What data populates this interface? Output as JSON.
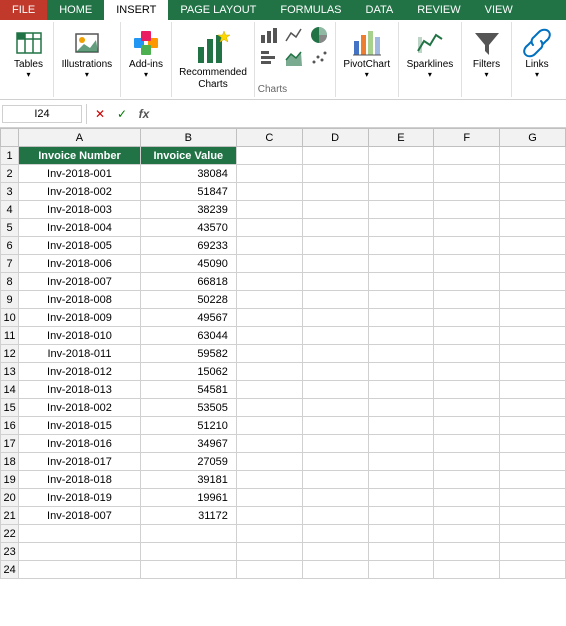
{
  "tabs": [
    {
      "id": "file",
      "label": "FILE"
    },
    {
      "id": "home",
      "label": "HOME"
    },
    {
      "id": "insert",
      "label": "INSERT",
      "active": true
    },
    {
      "id": "page-layout",
      "label": "PAGE LAYOUT"
    },
    {
      "id": "formulas",
      "label": "FORMULAS"
    },
    {
      "id": "data",
      "label": "DATA"
    },
    {
      "id": "review",
      "label": "REVIEW"
    },
    {
      "id": "view",
      "label": "VIEW"
    }
  ],
  "groups": {
    "tables": {
      "label": "Tables"
    },
    "illustrations": {
      "label": "Illustrations"
    },
    "add_ins": {
      "label": "Add-ins"
    },
    "recommended_charts": {
      "label": "Recommended",
      "sublabel": "Charts"
    },
    "charts": {
      "label": "Charts"
    },
    "pivot_chart": {
      "label": "PivotChart"
    },
    "sparklines": {
      "label": "Sparklines"
    },
    "filters": {
      "label": "Filters"
    },
    "links": {
      "label": "Links"
    }
  },
  "buttons": {
    "tables": "Tables",
    "illustrations": "Illustrations",
    "add_ins": "Add-ins",
    "recommended_charts": "Recommended\nCharts",
    "pivot_chart": "PivotChart",
    "sparklines": "Sparklines",
    "filters": "Filters",
    "links": "Links"
  },
  "formula_bar": {
    "cell_ref": "I24",
    "cancel_label": "✕",
    "confirm_label": "✓",
    "function_label": "fx",
    "formula_value": ""
  },
  "columns": [
    "",
    "A",
    "B",
    "C",
    "D",
    "E",
    "F",
    "G"
  ],
  "headers": {
    "col_a": "Invoice Number",
    "col_b": "Invoice Value"
  },
  "rows": [
    {
      "num": 1,
      "a": "Invoice Number",
      "b": "Invoice Value",
      "header": true
    },
    {
      "num": 2,
      "a": "Inv-2018-001",
      "b": "38084"
    },
    {
      "num": 3,
      "a": "Inv-2018-002",
      "b": "51847"
    },
    {
      "num": 4,
      "a": "Inv-2018-003",
      "b": "38239"
    },
    {
      "num": 5,
      "a": "Inv-2018-004",
      "b": "43570"
    },
    {
      "num": 6,
      "a": "Inv-2018-005",
      "b": "69233"
    },
    {
      "num": 7,
      "a": "Inv-2018-006",
      "b": "45090"
    },
    {
      "num": 8,
      "a": "Inv-2018-007",
      "b": "66818"
    },
    {
      "num": 9,
      "a": "Inv-2018-008",
      "b": "50228"
    },
    {
      "num": 10,
      "a": "Inv-2018-009",
      "b": "49567"
    },
    {
      "num": 11,
      "a": "Inv-2018-010",
      "b": "63044"
    },
    {
      "num": 12,
      "a": "Inv-2018-011",
      "b": "59582"
    },
    {
      "num": 13,
      "a": "Inv-2018-012",
      "b": "15062"
    },
    {
      "num": 14,
      "a": "Inv-2018-013",
      "b": "54581"
    },
    {
      "num": 15,
      "a": "Inv-2018-002",
      "b": "53505"
    },
    {
      "num": 16,
      "a": "Inv-2018-015",
      "b": "51210"
    },
    {
      "num": 17,
      "a": "Inv-2018-016",
      "b": "34967"
    },
    {
      "num": 18,
      "a": "Inv-2018-017",
      "b": "27059"
    },
    {
      "num": 19,
      "a": "Inv-2018-018",
      "b": "39181"
    },
    {
      "num": 20,
      "a": "Inv-2018-019",
      "b": "19961"
    },
    {
      "num": 21,
      "a": "Inv-2018-007",
      "b": "31172"
    },
    {
      "num": 22,
      "a": "",
      "b": ""
    },
    {
      "num": 23,
      "a": "",
      "b": ""
    },
    {
      "num": 24,
      "a": "",
      "b": ""
    }
  ],
  "colors": {
    "ribbon_green": "#217346",
    "header_bg": "#217346",
    "header_text": "#ffffff",
    "tab_active_bg": "#ffffff",
    "tab_active_text": "#000000"
  }
}
